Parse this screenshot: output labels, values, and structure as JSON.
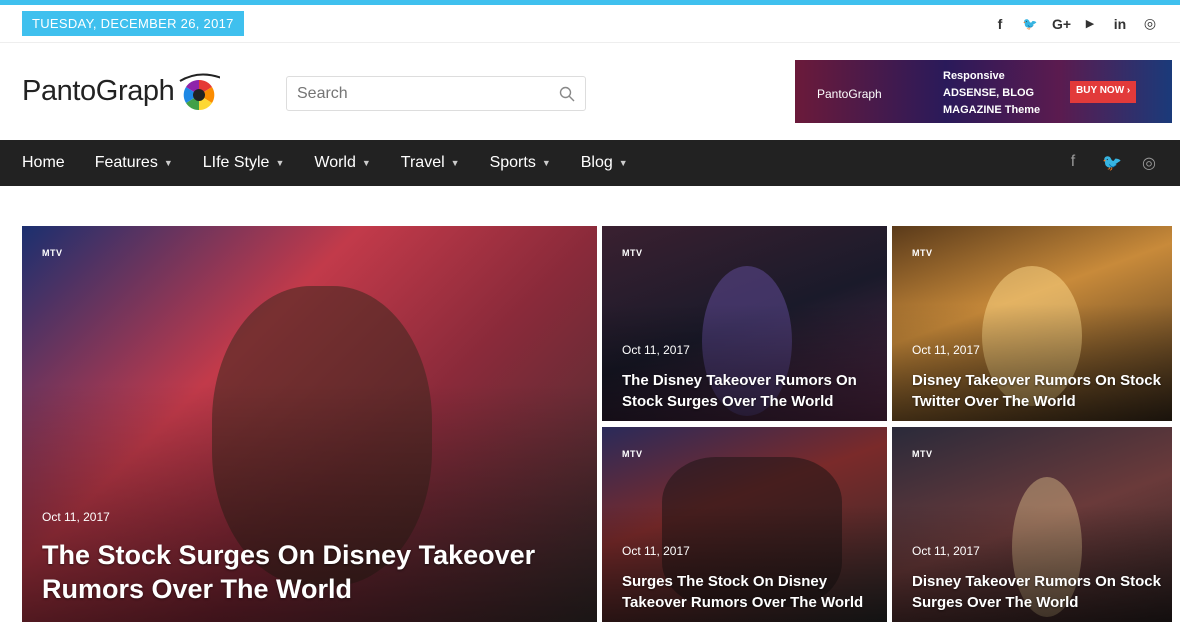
{
  "topbar": {
    "date": "TUESDAY, DECEMBER 26, 2017",
    "social": [
      {
        "icon": "facebook-icon",
        "glyph": "f"
      },
      {
        "icon": "twitter-icon",
        "glyph": "🐦"
      },
      {
        "icon": "google-plus-icon",
        "glyph": "G+"
      },
      {
        "icon": "youtube-icon",
        "glyph": "▶"
      },
      {
        "icon": "linkedin-icon",
        "glyph": "in"
      },
      {
        "icon": "instagram-icon",
        "glyph": "◎"
      }
    ]
  },
  "header": {
    "logo": "PantoGraph",
    "search_placeholder": "Search",
    "ad": {
      "logo": "PantoGraph",
      "line1": "Responsive",
      "line2": "ADSENSE, BLOG",
      "line3": "MAGAZINE Theme",
      "button": "BUY NOW ›"
    }
  },
  "nav": {
    "items": [
      {
        "label": "Home",
        "dropdown": false
      },
      {
        "label": "Features",
        "dropdown": true
      },
      {
        "label": "LIfe Style",
        "dropdown": true
      },
      {
        "label": "World",
        "dropdown": true
      },
      {
        "label": "Travel",
        "dropdown": true
      },
      {
        "label": "Sports",
        "dropdown": true
      },
      {
        "label": "Blog",
        "dropdown": true
      }
    ],
    "social": [
      "facebook-icon",
      "twitter-icon",
      "instagram-icon"
    ]
  },
  "featured": {
    "big": {
      "category": "MTV",
      "date": "Oct 11, 2017",
      "title": "The Stock Surges On Disney Takeover Rumors Over The World"
    },
    "small": [
      {
        "category": "MTV",
        "date": "Oct 11, 2017",
        "title": "The Disney Takeover Rumors On Stock Surges Over The World"
      },
      {
        "category": "MTV",
        "date": "Oct 11, 2017",
        "title": "Disney Takeover Rumors On Stock Twitter Over The World"
      },
      {
        "category": "MTV",
        "date": "Oct 11, 2017",
        "title": "Surges The Stock On Disney Takeover Rumors Over The World"
      },
      {
        "category": "MTV",
        "date": "Oct 11, 2017",
        "title": "Disney Takeover Rumors On Stock Surges Over The World"
      }
    ]
  },
  "colors": {
    "accent": "#3fc0ee",
    "nav_bg": "#222222",
    "ad_button": "#e23a3a"
  }
}
